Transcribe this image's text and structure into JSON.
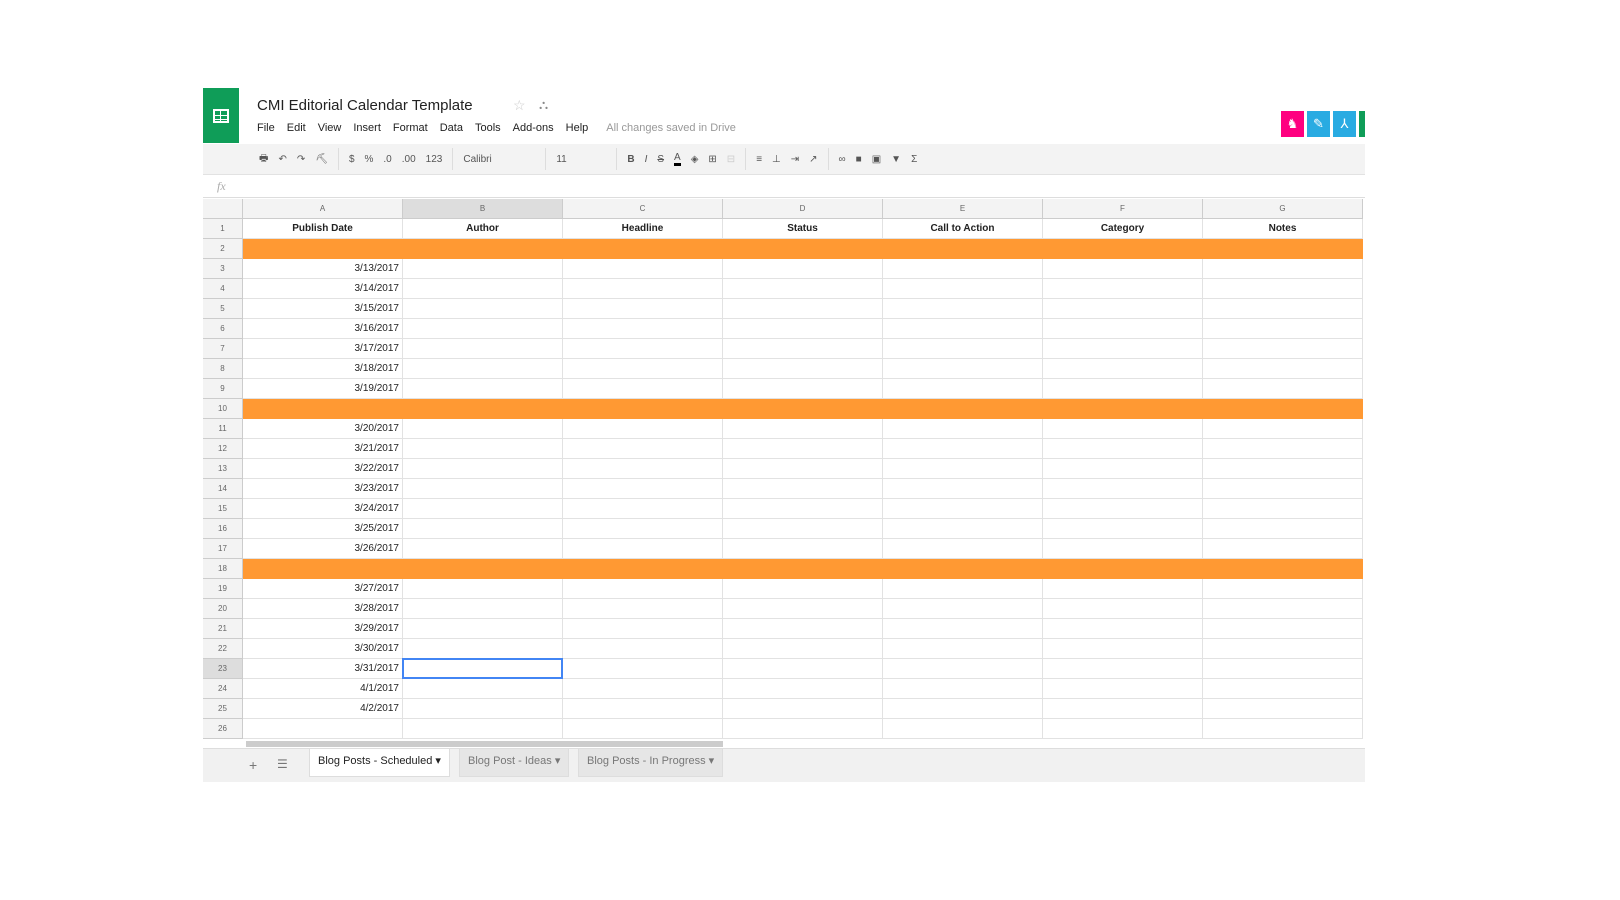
{
  "title": "CMI Editorial Calendar Template",
  "menu": [
    "File",
    "Edit",
    "View",
    "Insert",
    "Format",
    "Data",
    "Tools",
    "Add-ons",
    "Help"
  ],
  "save_status": "All changes saved in Drive",
  "toolbar": {
    "currency": "$",
    "percent": "%",
    "dec_less": ".0",
    "dec_more": ".00",
    "format": "123",
    "font": "Calibri",
    "size": "11"
  },
  "fx": "fx",
  "columns": [
    "A",
    "B",
    "C",
    "D",
    "E",
    "F",
    "G"
  ],
  "headers": [
    "Publish Date",
    "Author",
    "Headline",
    "Status",
    "Call to Action",
    "Category",
    "Notes"
  ],
  "dates": {
    "3": "3/13/2017",
    "4": "3/14/2017",
    "5": "3/15/2017",
    "6": "3/16/2017",
    "7": "3/17/2017",
    "8": "3/18/2017",
    "9": "3/19/2017",
    "11": "3/20/2017",
    "12": "3/21/2017",
    "13": "3/22/2017",
    "14": "3/23/2017",
    "15": "3/24/2017",
    "16": "3/25/2017",
    "17": "3/26/2017",
    "19": "3/27/2017",
    "20": "3/28/2017",
    "21": "3/29/2017",
    "22": "3/30/2017",
    "23": "3/31/2017",
    "24": "4/1/2017",
    "25": "4/2/2017"
  },
  "orange_rows": [
    2,
    10,
    18
  ],
  "row_count": 26,
  "selected_cell": "B23",
  "colors": {
    "accent": "#ff9933",
    "brand": "#0f9d58",
    "selection": "#4285f4"
  },
  "sheet_tabs": [
    {
      "label": "Blog Posts - Scheduled",
      "active": true
    },
    {
      "label": "Blog Post - Ideas",
      "active": false
    },
    {
      "label": "Blog Posts - In Progress",
      "active": false
    }
  ]
}
